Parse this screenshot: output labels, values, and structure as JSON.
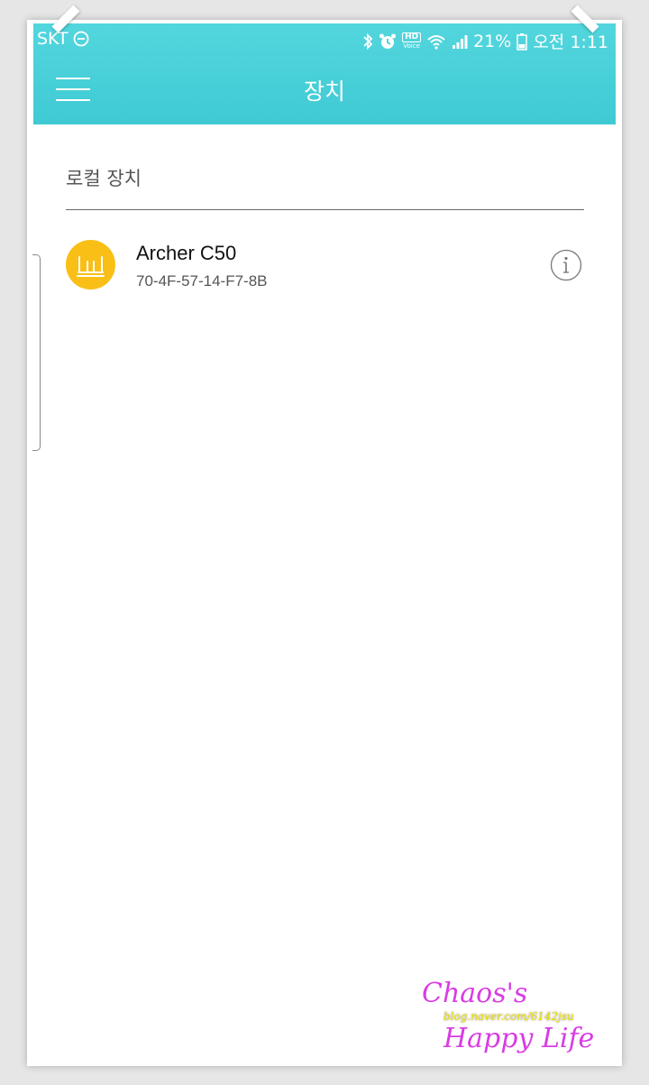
{
  "status_bar": {
    "carrier": "SKT",
    "battery_percent": "21%",
    "time": "오전 1:11",
    "hd_label": "HD",
    "voice_label": "Voice",
    "icons": [
      "do-not-disturb-icon",
      "bluetooth-icon",
      "alarm-icon",
      "hd-voice-icon",
      "wifi-icon",
      "signal-icon",
      "battery-icon"
    ]
  },
  "app_bar": {
    "title": "장치",
    "menu_icon": "hamburger-menu-icon"
  },
  "local_devices": {
    "section_title": "로컬 장치",
    "devices": [
      {
        "name": "Archer C50",
        "mac": "70-4F-57-14-F7-8B",
        "icon": "router-icon",
        "action_icon": "info-icon"
      }
    ]
  },
  "watermark": {
    "line1": "Chaos's",
    "url": "blog.naver.com/6142jsu",
    "line2": "Happy Life"
  },
  "colors": {
    "app_bar": "#47cfd8",
    "device_avatar": "#f9bf17",
    "watermark_text": "#d83ce4",
    "watermark_url": "#f2e300"
  }
}
